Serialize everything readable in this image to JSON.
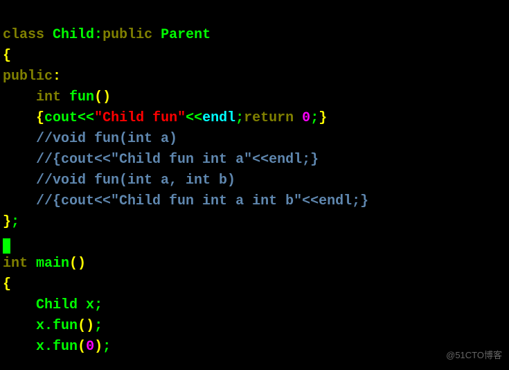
{
  "line1": {
    "class": "class",
    "child": "Child",
    "colon": ":",
    "public": "public",
    "parent": "Parent"
  },
  "line2": {
    "brace": "{"
  },
  "line3": {
    "public": "public",
    "colon": ":"
  },
  "line4": {
    "indent": "    ",
    "int": "int",
    "sp": " ",
    "fun": "fun",
    "par": "()"
  },
  "line5": {
    "indent": "    ",
    "lb": "{",
    "cout": "cout",
    "ll1": "<<",
    "str": "\"Child fun\"",
    "ll2": "<<",
    "endl": "endl",
    "semi": ";",
    "ret": "return",
    "sp": " ",
    "zero": "0",
    "semi2": ";",
    "rb": "}"
  },
  "line6": {
    "indent": "    ",
    "text": "//void fun(int a)"
  },
  "line7": {
    "indent": "    ",
    "text": "//{cout<<\"Child fun int a\"<<endl;}"
  },
  "line8": {
    "indent": "    ",
    "text": "//void fun(int a, int b)"
  },
  "line9": {
    "indent": "    ",
    "text": "//{cout<<\"Child fun int a int b\"<<endl;}"
  },
  "line10": {
    "brace": "}",
    "semi": ";"
  },
  "line12": {
    "int": "int",
    "sp": " ",
    "main": "main",
    "par": "()"
  },
  "line13": {
    "brace": "{"
  },
  "line14": {
    "indent": "    ",
    "child": "Child",
    "sp": " ",
    "x": "x",
    "semi": ";"
  },
  "line15": {
    "indent": "    ",
    "x": "x",
    "dot": ".",
    "fun": "fun",
    "par": "()",
    "semi": ";"
  },
  "line16": {
    "indent": "    ",
    "x": "x",
    "dot": ".",
    "fun": "fun",
    "lp": "(",
    "zero": "0",
    "rp": ")",
    "semi": ";"
  },
  "watermark": "@51CTO博客"
}
